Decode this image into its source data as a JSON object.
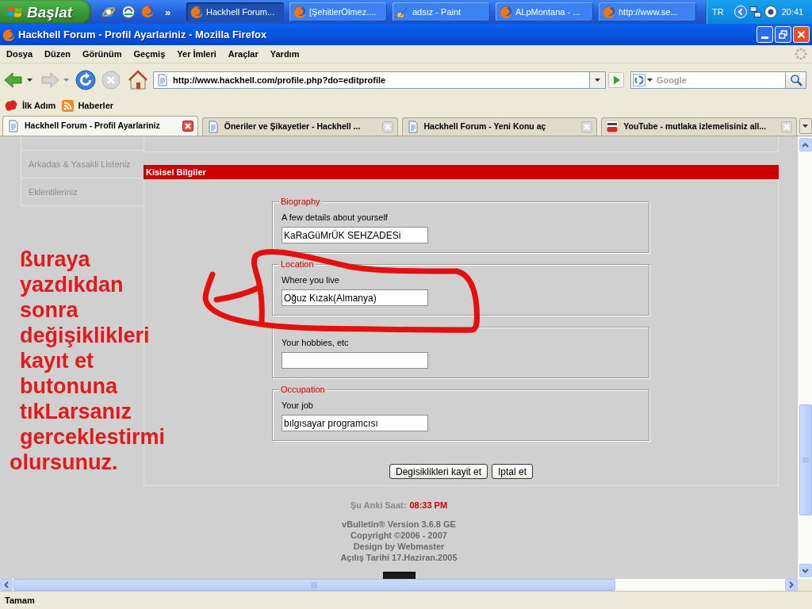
{
  "taskbar": {
    "start": {
      "label": "Başlat"
    },
    "quick_launch_more": "»",
    "tasks": [
      {
        "label": "Hackhell Forum...",
        "kind": "browser",
        "selected": true
      },
      {
        "label": "[ŞehitlerÖlmez....",
        "kind": "browser",
        "selected": false
      },
      {
        "label": "adsız - Paint",
        "kind": "paint",
        "selected": false
      },
      {
        "label": "ALpMontana - ...",
        "kind": "browser",
        "selected": false
      },
      {
        "label": "http://www.se...",
        "kind": "browser",
        "selected": false
      }
    ],
    "tray": {
      "language": "TR",
      "clock": "20:41"
    }
  },
  "window": {
    "title": "Hackhell Forum - Profil Ayarlariniz - Mozilla Firefox"
  },
  "menu_bar": [
    "Dosya",
    "Düzen",
    "Görünüm",
    "Geçmiş",
    "Yer İmleri",
    "Araçlar",
    "Yardım"
  ],
  "navigation": {
    "url": "http://www.hackhell.com/profile.php?do=editprofile",
    "search": {
      "placeholder": "Google"
    }
  },
  "bookmarks": [
    {
      "label": "İlk Adım",
      "kind": "page"
    },
    {
      "label": "Haberler",
      "kind": "feed"
    }
  ],
  "tabs": [
    {
      "label": "Hackhell Forum - Profil Ayarlariniz",
      "kind": "page",
      "selected": true
    },
    {
      "label": "Öneriler ve Şikayetler - Hackhell ...",
      "kind": "page",
      "selected": false
    },
    {
      "label": "Hackhell Forum - Yeni Konu aç",
      "kind": "page",
      "selected": false
    },
    {
      "label": "YouTube - mutlaka izlemelisiniz all...",
      "kind": "video",
      "selected": false
    }
  ],
  "page": {
    "sidebar": {
      "items": [
        "Arkadas & Yasakli Listeniz",
        "Eklentileriniz"
      ]
    },
    "section": {
      "title": "Kisisel Bilgiler",
      "fieldsets": [
        {
          "legend": "Biography",
          "label": "A few details about yourself",
          "value": "KaRaGüMrÜK SEHZADESi"
        },
        {
          "legend": "Location",
          "label": "Where you live",
          "value": "Oğuz Kızak(Almanya)"
        },
        {
          "label": "Your hobbies, etc"
        },
        {
          "legend": "Occupation",
          "label": "Your job",
          "value": "bılgısayar programcısı"
        }
      ],
      "buttons": [
        "Degisiklikleri kayit et",
        "Iptal et"
      ]
    },
    "footer": {
      "time_label": "Şu Anki Saat:",
      "time": "08:33 PM",
      "lines": [
        "vBulletin® Version 3.6.8 GE",
        "Copyright ©2006 - 2007",
        "Design by Webmaster",
        "Açılış Tarihi 17.Haziran.2005"
      ]
    }
  },
  "annotation": {
    "lines": [
      "ßuraya",
      "yazdıkdan",
      "sonra",
      "değişiklikleri",
      "kayıt et",
      "butonuna",
      "tıkLarsanız",
      "gerceklestirmi",
      "olursunuz."
    ]
  },
  "status_bar": {
    "text": "Tamam"
  }
}
